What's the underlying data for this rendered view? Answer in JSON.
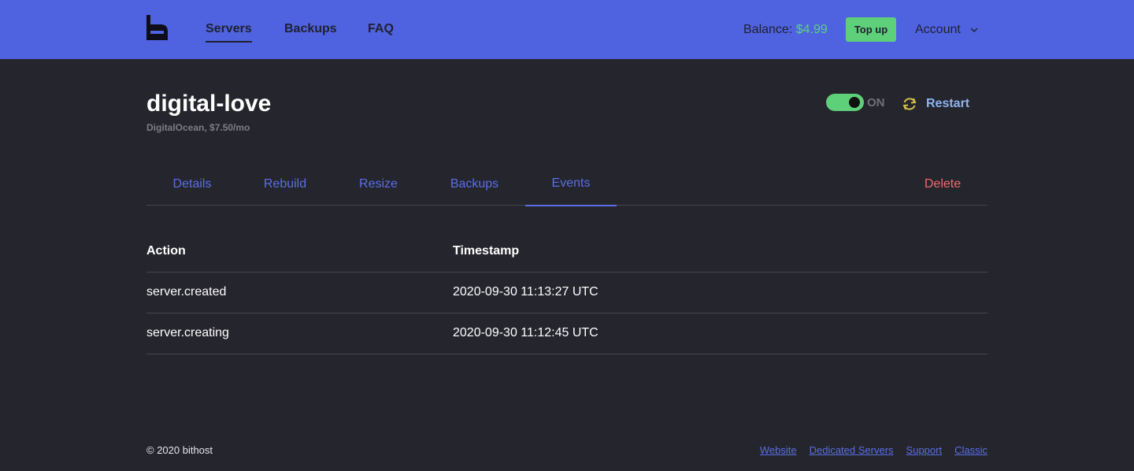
{
  "nav": {
    "logo_icon": "bithost-logo-icon",
    "links": [
      {
        "label": "Servers",
        "active": true
      },
      {
        "label": "Backups",
        "active": false
      },
      {
        "label": "FAQ",
        "active": false
      }
    ],
    "balance_label": "Balance:",
    "balance_amount": "$4.99",
    "topup_label": "Top up",
    "account_label": "Account",
    "account_icon": "chevron-down-icon"
  },
  "server": {
    "name": "digital-love",
    "subtitle": "DigitalOcean, $7.50/mo",
    "power_state": "ON",
    "power_on": true,
    "restart_label": "Restart",
    "restart_icon": "refresh-icon"
  },
  "tabs": [
    {
      "label": "Details",
      "active": false
    },
    {
      "label": "Rebuild",
      "active": false
    },
    {
      "label": "Resize",
      "active": false
    },
    {
      "label": "Backups",
      "active": false
    },
    {
      "label": "Events",
      "active": true
    }
  ],
  "delete_label": "Delete",
  "events": {
    "columns": [
      "Action",
      "Timestamp"
    ],
    "rows": [
      {
        "action": "server.created",
        "timestamp": "2020-09-30 11:13:27 UTC"
      },
      {
        "action": "server.creating",
        "timestamp": "2020-09-30 11:12:45 UTC"
      }
    ]
  },
  "footer": {
    "copyright": "© 2020 bithost",
    "links": [
      "Website",
      "Dedicated Servers",
      "Support",
      "Classic"
    ]
  },
  "colors": {
    "navbar": "#4f63e0",
    "background": "#25252d",
    "accent_green": "#5fd07a",
    "link_blue": "#5a6fe5",
    "danger": "#ef6b6b"
  }
}
